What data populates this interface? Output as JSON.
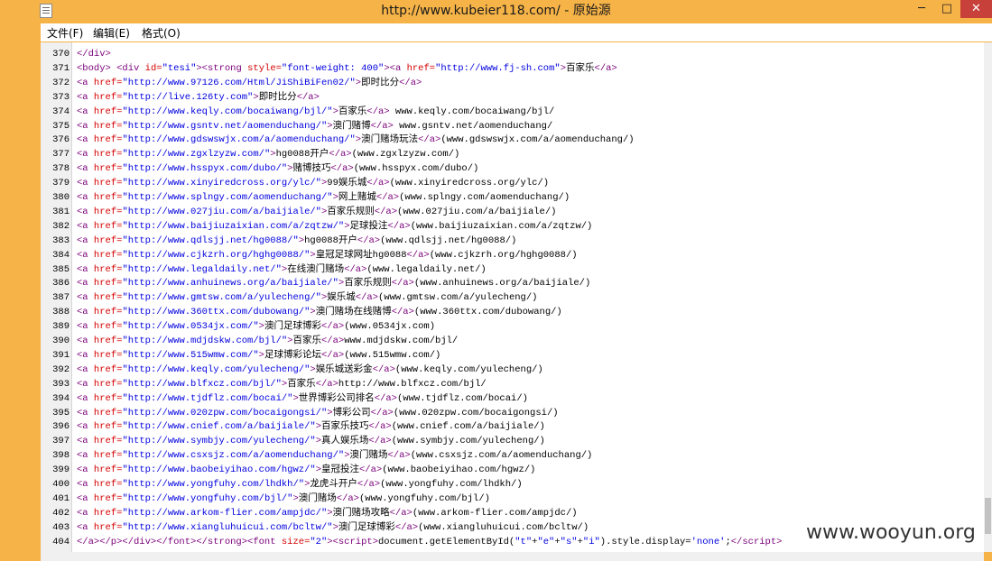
{
  "window": {
    "title": "http://www.kubeier118.com/ - 原始源",
    "minimize": "─",
    "maximize": "□",
    "close": "✕",
    "icon": "notepad-icon"
  },
  "menu": [
    "文件(F)",
    "编辑(E)",
    "格式(O)"
  ],
  "watermark": "www.wooyun.org",
  "lines": [
    {
      "n": "370",
      "html": "<span class=\"tag\">&lt;/div&gt;</span>"
    },
    {
      "n": "371",
      "html": "<span class=\"tag\">&lt;body&gt;</span>  <span class=\"tag\">&lt;div</span> <span class=\"attr\">id=</span><span class=\"val\">\"tesi\"</span><span class=\"tag\">&gt;&lt;strong</span> <span class=\"attr\">style=</span><span class=\"val\">\"font-weight: 400\"</span><span class=\"tag\">&gt;&lt;a</span> <span class=\"attr\">href=</span><span class=\"val\">\"http://www.fj-sh.com\"</span><span class=\"tag\">&gt;</span>百家乐<span class=\"tag\">&lt;/a&gt;</span>"
    },
    {
      "n": "372",
      "html": "<span class=\"tag\">&lt;a</span> <span class=\"attr\">href=</span><span class=\"val\">\"http://www.97126.com/Html/JiShiBiFen02/\"</span><span class=\"tag\">&gt;</span>即时比分<span class=\"tag\">&lt;/a&gt;</span>"
    },
    {
      "n": "373",
      "html": "<span class=\"tag\">&lt;a</span> <span class=\"attr\">href=</span><span class=\"val\">\"http://live.126ty.com\"</span><span class=\"tag\">&gt;</span>即时比分<span class=\"tag\">&lt;/a&gt;</span>"
    },
    {
      "n": "374",
      "html": "<span class=\"tag\">&lt;a</span> <span class=\"attr\">href=</span><span class=\"val\">\"http://www.keqly.com/bocaiwang/bjl/\"</span><span class=\"tag\">&gt;</span>百家乐<span class=\"tag\">&lt;/a&gt;</span> www.keqly.com/bocaiwang/bjl/"
    },
    {
      "n": "375",
      "html": "<span class=\"tag\">&lt;a</span> <span class=\"attr\">href=</span><span class=\"val\">\"http://www.gsntv.net/aomenduchang/\"</span><span class=\"tag\">&gt;</span>澳门赌博<span class=\"tag\">&lt;/a&gt;</span> www.gsntv.net/aomenduchang/"
    },
    {
      "n": "376",
      "html": "<span class=\"tag\">&lt;a</span> <span class=\"attr\">href=</span><span class=\"val\">\"http://www.gdswswjx.com/a/aomenduchang/\"</span><span class=\"tag\">&gt;</span>澳门赌场玩法<span class=\"tag\">&lt;/a&gt;</span>(www.gdswswjx.com/a/aomenduchang/)"
    },
    {
      "n": "377",
      "html": "<span class=\"tag\">&lt;a</span> <span class=\"attr\">href=</span><span class=\"val\">\"http://www.zgxlzyzw.com/\"</span><span class=\"tag\">&gt;</span>hg0088开户<span class=\"tag\">&lt;/a&gt;</span>(www.zgxlzyzw.com/)"
    },
    {
      "n": "378",
      "html": "<span class=\"tag\">&lt;a</span> <span class=\"attr\">href=</span><span class=\"val\">\"http://www.hsspyx.com/dubo/\"</span><span class=\"tag\">&gt;</span>赌博技巧<span class=\"tag\">&lt;/a&gt;</span>(www.hsspyx.com/dubo/)"
    },
    {
      "n": "379",
      "html": "<span class=\"tag\">&lt;a</span> <span class=\"attr\">href=</span><span class=\"val\">\"http://www.xinyiredcross.org/ylc/\"</span><span class=\"tag\">&gt;</span>99娱乐城<span class=\"tag\">&lt;/a&gt;</span>(www.xinyiredcross.org/ylc/)"
    },
    {
      "n": "380",
      "html": "<span class=\"tag\">&lt;a</span> <span class=\"attr\">href=</span><span class=\"val\">\"http://www.splngy.com/aomenduchang/\"</span><span class=\"tag\">&gt;</span>网上赌城<span class=\"tag\">&lt;/a&gt;</span>(www.splngy.com/aomenduchang/)"
    },
    {
      "n": "381",
      "html": "<span class=\"tag\">&lt;a</span> <span class=\"attr\">href=</span><span class=\"val\">\"http://www.027jiu.com/a/baijiale/\"</span><span class=\"tag\">&gt;</span>百家乐规则<span class=\"tag\">&lt;/a&gt;</span>(www.027jiu.com/a/baijiale/)"
    },
    {
      "n": "382",
      "html": "<span class=\"tag\">&lt;a</span> <span class=\"attr\">href=</span><span class=\"val\">\"http://www.baijiuzaixian.com/a/zqtzw/\"</span><span class=\"tag\">&gt;</span>足球投注<span class=\"tag\">&lt;/a&gt;</span>(www.baijiuzaixian.com/a/zqtzw/)"
    },
    {
      "n": "383",
      "html": "<span class=\"tag\">&lt;a</span> <span class=\"attr\">href=</span><span class=\"val\">\"http://www.qdlsjj.net/hg0088/\"</span><span class=\"tag\">&gt;</span>hg0088开户<span class=\"tag\">&lt;/a&gt;</span>(www.qdlsjj.net/hg0088/)"
    },
    {
      "n": "384",
      "html": "<span class=\"tag\">&lt;a</span> <span class=\"attr\">href=</span><span class=\"val\">\"http://www.cjkzrh.org/hghg0088/\"</span><span class=\"tag\">&gt;</span>皇冠足球网址hg0088<span class=\"tag\">&lt;/a&gt;</span>(www.cjkzrh.org/hghg0088/)"
    },
    {
      "n": "385",
      "html": "<span class=\"tag\">&lt;a</span> <span class=\"attr\">href=</span><span class=\"val\">\"http://www.legaldaily.net/\"</span><span class=\"tag\">&gt;</span>在线澳门赌场<span class=\"tag\">&lt;/a&gt;</span>(www.legaldaily.net/)"
    },
    {
      "n": "386",
      "html": "<span class=\"tag\">&lt;a</span> <span class=\"attr\">href=</span><span class=\"val\">\"http://www.anhuinews.org/a/baijiale/\"</span><span class=\"tag\">&gt;</span>百家乐规则<span class=\"tag\">&lt;/a&gt;</span>(www.anhuinews.org/a/baijiale/)"
    },
    {
      "n": "387",
      "html": "<span class=\"tag\">&lt;a</span> <span class=\"attr\">href=</span><span class=\"val\">\"http://www.gmtsw.com/a/yulecheng/\"</span><span class=\"tag\">&gt;</span>娱乐城<span class=\"tag\">&lt;/a&gt;</span>(www.gmtsw.com/a/yulecheng/)"
    },
    {
      "n": "388",
      "html": "<span class=\"tag\">&lt;a</span> <span class=\"attr\">href=</span><span class=\"val\">\"http://www.360ttx.com/dubowang/\"</span><span class=\"tag\">&gt;</span>澳门赌场在线赌博<span class=\"tag\">&lt;/a&gt;</span>(www.360ttx.com/dubowang/)"
    },
    {
      "n": "389",
      "html": "<span class=\"tag\">&lt;a</span> <span class=\"attr\">href=</span><span class=\"val\">\"http://www.0534jx.com/\"</span><span class=\"tag\">&gt;</span>澳门足球博彩<span class=\"tag\">&lt;/a&gt;</span>(www.0534jx.com)"
    },
    {
      "n": "390",
      "html": "<span class=\"tag\">&lt;a</span> <span class=\"attr\">href=</span><span class=\"val\">\"http://www.mdjdskw.com/bjl/\"</span><span class=\"tag\">&gt;</span>百家乐<span class=\"tag\">&lt;/a&gt;</span>www.mdjdskw.com/bjl/"
    },
    {
      "n": "391",
      "html": "<span class=\"tag\">&lt;a</span> <span class=\"attr\">href=</span><span class=\"val\">\"http://www.515wmw.com/\"</span><span class=\"tag\">&gt;</span>足球博彩论坛<span class=\"tag\">&lt;/a&gt;</span>(www.515wmw.com/)"
    },
    {
      "n": "392",
      "html": "<span class=\"tag\">&lt;a</span> <span class=\"attr\">href=</span><span class=\"val\">\"http://www.keqly.com/yulecheng/\"</span><span class=\"tag\">&gt;</span>娱乐城送彩金<span class=\"tag\">&lt;/a&gt;</span>(www.keqly.com/yulecheng/)"
    },
    {
      "n": "393",
      "html": "<span class=\"tag\">&lt;a</span> <span class=\"attr\">href=</span><span class=\"val\">\"http://www.blfxcz.com/bjl/\"</span><span class=\"tag\">&gt;</span>百家乐<span class=\"tag\">&lt;/a&gt;</span>http://www.blfxcz.com/bjl/"
    },
    {
      "n": "394",
      "html": "<span class=\"tag\">&lt;a</span> <span class=\"attr\">href=</span><span class=\"val\">\"http://www.tjdflz.com/bocai/\"</span><span class=\"tag\">&gt;</span>世界博彩公司排名<span class=\"tag\">&lt;/a&gt;</span>(www.tjdflz.com/bocai/)"
    },
    {
      "n": "395",
      "html": "<span class=\"tag\">&lt;a</span> <span class=\"attr\">href=</span><span class=\"val\">\"http://www.020zpw.com/bocaigongsi/\"</span><span class=\"tag\">&gt;</span>博彩公司<span class=\"tag\">&lt;/a&gt;</span>(www.020zpw.com/bocaigongsi/)"
    },
    {
      "n": "396",
      "html": "<span class=\"tag\">&lt;a</span> <span class=\"attr\">href=</span><span class=\"val\">\"http://www.cnief.com/a/baijiale/\"</span><span class=\"tag\">&gt;</span>百家乐技巧<span class=\"tag\">&lt;/a&gt;</span>(www.cnief.com/a/baijiale/)"
    },
    {
      "n": "397",
      "html": "<span class=\"tag\">&lt;a</span> <span class=\"attr\">href=</span><span class=\"val\">\"http://www.symbjy.com/yulecheng/\"</span><span class=\"tag\">&gt;</span>真人娱乐场<span class=\"tag\">&lt;/a&gt;</span>(www.symbjy.com/yulecheng/)"
    },
    {
      "n": "398",
      "html": "<span class=\"tag\">&lt;a</span> <span class=\"attr\">href=</span><span class=\"val\">\"http://www.csxsjz.com/a/aomenduchang/\"</span><span class=\"tag\">&gt;</span>澳门赌场<span class=\"tag\">&lt;/a&gt;</span>(www.csxsjz.com/a/aomenduchang/)"
    },
    {
      "n": "399",
      "html": "<span class=\"tag\">&lt;a</span> <span class=\"attr\">href=</span><span class=\"val\">\"http://www.baobeiyihao.com/hgwz/\"</span><span class=\"tag\">&gt;</span>皇冠投注<span class=\"tag\">&lt;/a&gt;</span>(www.baobeiyihao.com/hgwz/)"
    },
    {
      "n": "400",
      "html": "<span class=\"tag\">&lt;a</span> <span class=\"attr\">href=</span><span class=\"val\">\"http://www.yongfuhy.com/lhdkh/\"</span><span class=\"tag\">&gt;</span>龙虎斗开户<span class=\"tag\">&lt;/a&gt;</span>(www.yongfuhy.com/lhdkh/)"
    },
    {
      "n": "401",
      "html": "<span class=\"tag\">&lt;a</span> <span class=\"attr\">href=</span><span class=\"val\">\"http://www.yongfuhy.com/bjl/\"</span><span class=\"tag\">&gt;</span>澳门赌场<span class=\"tag\">&lt;/a&gt;</span>(www.yongfuhy.com/bjl/)"
    },
    {
      "n": "402",
      "html": "<span class=\"tag\">&lt;a</span> <span class=\"attr\">href=</span><span class=\"val\">\"http://www.arkom-flier.com/ampjdc/\"</span><span class=\"tag\">&gt;</span>澳门赌场攻略<span class=\"tag\">&lt;/a&gt;</span>(www.arkom-flier.com/ampjdc/)"
    },
    {
      "n": "403",
      "html": "<span class=\"tag\">&lt;a</span> <span class=\"attr\">href=</span><span class=\"val\">\"http://www.xiangluhuicui.com/bcltw/\"</span><span class=\"tag\">&gt;</span>澳门足球博彩<span class=\"tag\">&lt;/a&gt;</span>(www.xiangluhuicui.com/bcltw/)"
    },
    {
      "n": "404",
      "html": "<span class=\"tag\">&lt;/a&gt;&lt;/p&gt;&lt;/div&gt;&lt;/font&gt;&lt;/strong&gt;&lt;font</span> <span class=\"attr\">size=</span><span class=\"val\">\"2\"</span><span class=\"tag\">&gt;&lt;script&gt;</span>document.getElementById(<span class=\"val\">\"t\"</span>+<span class=\"val\">\"e\"</span>+<span class=\"val\">\"s\"</span>+<span class=\"val\">\"i\"</span>).style.display=<span class=\"val\">'none'</span>;<span class=\"tag\">&lt;/script&gt;</span>"
    }
  ]
}
